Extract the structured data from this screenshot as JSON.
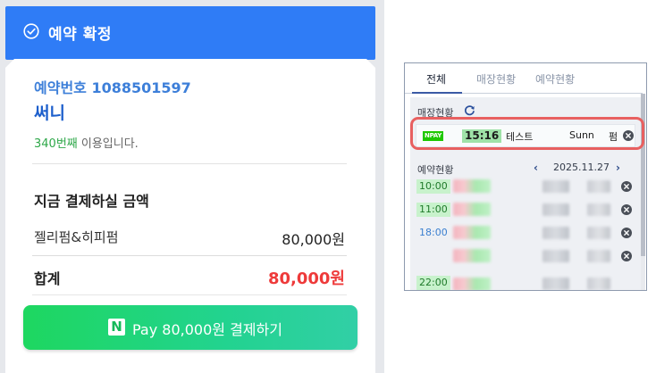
{
  "confirm": {
    "header_title": "예약 확정",
    "booking_number": "예약번호 1088501597",
    "customer_name": "써니",
    "visit_count": "340번째",
    "visit_suffix": " 이용입니다.",
    "payment_title": "지금 결제하실 금액",
    "item_name": "젤리펌&히피펌",
    "item_price": "80,000원",
    "total_label": "합계",
    "total_value": "80,000원",
    "pay_button_logo": "N",
    "pay_button_label": "Pay 80,000원 결제하기"
  },
  "panel": {
    "tabs": [
      {
        "label": "전체",
        "active": true
      },
      {
        "label": "매장현황",
        "active": false
      },
      {
        "label": "예약현황",
        "active": false
      }
    ],
    "store_section_label": "매장현황",
    "store_row": {
      "badge": "NPAY",
      "time": "15:16",
      "name": "테스트",
      "user": "Sunn",
      "item": "펌"
    },
    "reservation_section_label": "예약현황",
    "date": "2025.11.27",
    "reservations": [
      {
        "time": "10:00",
        "highlighted": true
      },
      {
        "time": "11:00",
        "highlighted": true
      },
      {
        "time": "18:00",
        "highlighted": false
      },
      {
        "time": "",
        "highlighted": false
      },
      {
        "time": "22:00",
        "highlighted": true
      }
    ]
  },
  "colors": {
    "header_blue": "#2f7cf6",
    "booking_blue": "#3d7fd9",
    "visit_green": "#2fa84a",
    "total_red": "#ee3a3a",
    "pay_green": "#1ed760",
    "highlight_red": "#e86060",
    "npay_green": "#1ec800"
  },
  "icons": {
    "header": "check-circle-icon",
    "refresh": "refresh-icon",
    "close": "close-circle-icon",
    "prev": "chevron-left-icon",
    "next": "chevron-right-icon"
  }
}
